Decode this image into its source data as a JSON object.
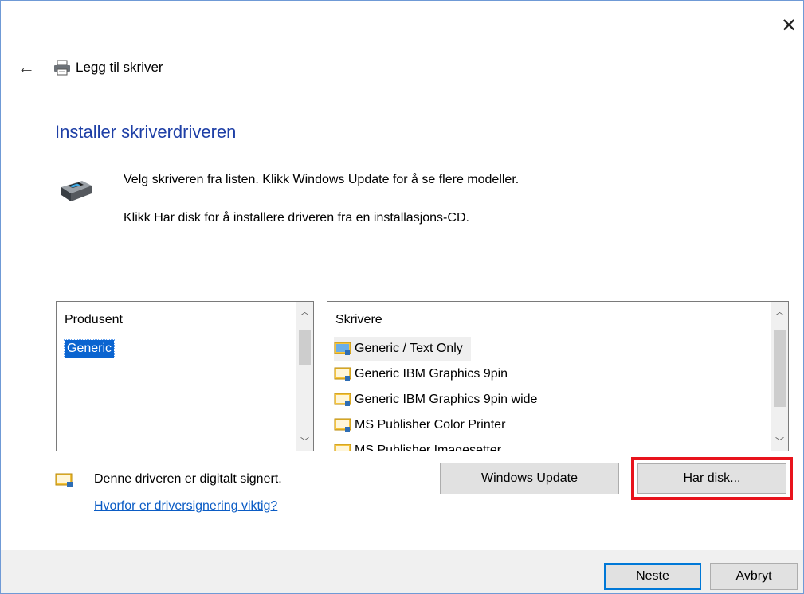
{
  "window": {
    "title": "Legg til skriver",
    "close_glyph": "✕",
    "back_glyph": "←"
  },
  "heading": "Installer skriverdriveren",
  "intro": {
    "line1": "Velg skriveren fra listen. Klikk Windows Update for å se flere modeller.",
    "line2": "Klikk Har disk for å installere driveren fra en installasjons-CD."
  },
  "manufacturer_list": {
    "header": "Produsent",
    "items": [
      "Generic"
    ],
    "selected": "Generic"
  },
  "printer_list": {
    "header": "Skrivere",
    "items": [
      "Generic / Text Only",
      "Generic IBM Graphics 9pin",
      "Generic IBM Graphics 9pin wide",
      "MS Publisher Color Printer",
      "MS Publisher Imagesetter"
    ],
    "selected": "Generic / Text Only"
  },
  "signature": {
    "text": "Denne driveren er digitalt signert.",
    "link": "Hvorfor er driversignering viktig?"
  },
  "buttons": {
    "windows_update": "Windows Update",
    "have_disk": "Har disk...",
    "next": "Neste",
    "cancel": "Avbryt"
  },
  "colors": {
    "heading": "#1e3fa6",
    "selection": "#0a64d0",
    "link": "#0b5cc5",
    "highlight_box": "#e8131c",
    "default_button_border": "#0078d7"
  },
  "icons": {
    "back": "back-arrow-icon",
    "close": "close-icon",
    "title_printer": "printer-icon",
    "driver": "printer-driver-icon",
    "signed": "signed-driver-icon"
  }
}
